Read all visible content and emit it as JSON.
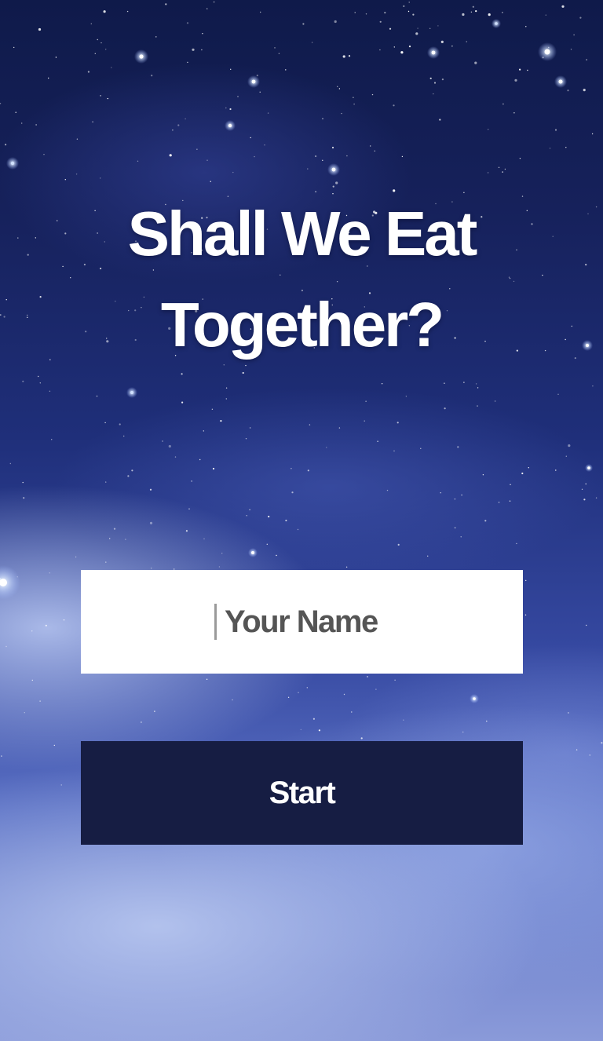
{
  "title": {
    "line1": "Shall We Eat",
    "line2": "Together?"
  },
  "name_field": {
    "placeholder": "Your Name",
    "value": ""
  },
  "start_button": {
    "label": "Start"
  },
  "colors": {
    "sky_top": "#0f1a4a",
    "sky_bottom": "#8a9ad9",
    "button_bg": "#161d43",
    "field_bg": "#ffffff",
    "placeholder_text": "#555555"
  }
}
